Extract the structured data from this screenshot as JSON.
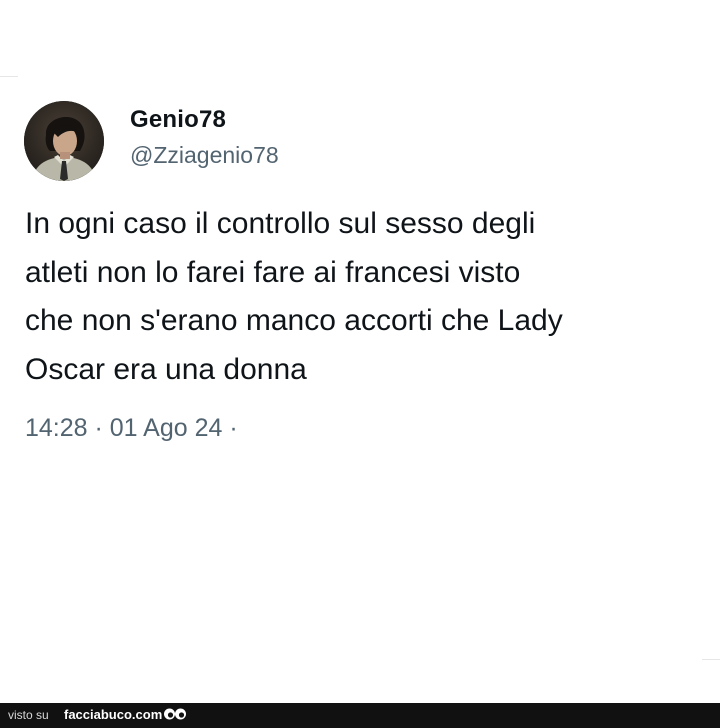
{
  "tweet": {
    "author_name": "Genio78",
    "author_handle": "@Zziagenio78",
    "text": "In ogni caso il controllo sul sesso degli\natleti non lo farei fare ai francesi visto\nche non s'erano manco accorti che Lady\nOscar era una donna",
    "timestamp": "14:28 · 01 Ago 24 ·",
    "avatar_icon": "profile-photo"
  },
  "footer": {
    "prefix": "visto su",
    "brand": "facciabuco.com",
    "logo_icon": "eyes-icon"
  },
  "colors": {
    "text_primary": "#0f1419",
    "text_secondary": "#536471",
    "footer_bg": "#111111"
  }
}
